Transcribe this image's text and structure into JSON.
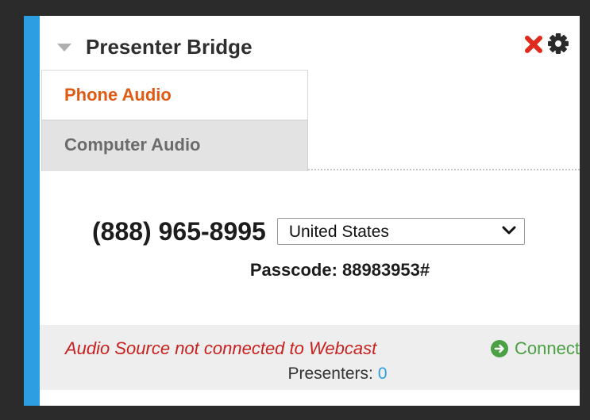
{
  "panel": {
    "title": "Presenter Bridge",
    "accent_color": "#2d9fe0",
    "icons": {
      "collapse": "caret-down-icon",
      "close": "close-icon",
      "settings": "gear-icon"
    }
  },
  "tabs": [
    {
      "label": "Phone Audio",
      "active": true
    },
    {
      "label": "Computer Audio",
      "active": false
    }
  ],
  "phone_audio": {
    "phone_number": "(888) 965-8995",
    "country_selected": "United States",
    "passcode_label": "Passcode: 88983953#"
  },
  "status": {
    "message": "Audio Source not connected to Webcast",
    "connect_label": "Connect",
    "presenters_label": "Presenters:",
    "presenters_count": "0",
    "colors": {
      "error": "#c8201e",
      "connect": "#4aa043",
      "count": "#2d9fe0"
    }
  }
}
